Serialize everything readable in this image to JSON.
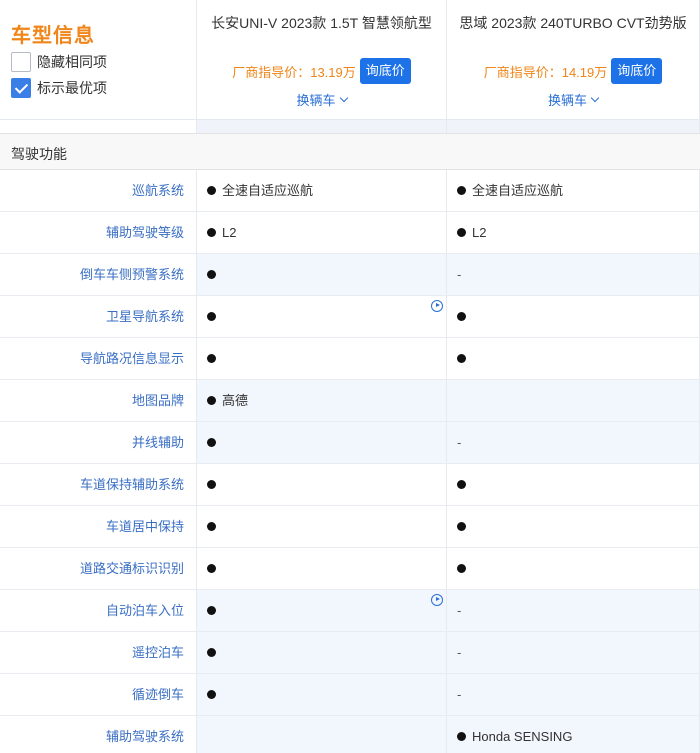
{
  "header": {
    "title": "车型信息",
    "hide_same_label": "隐藏相同项",
    "hide_same_checked": false,
    "mark_best_label": "标示最优项",
    "mark_best_checked": true,
    "cars": [
      {
        "name": "长安UNI-V 2023款 1.5T 智慧领航型",
        "price_label": "厂商指导价：",
        "price": "13.19万",
        "ask_label": "询底价",
        "swap_label": "换辆车"
      },
      {
        "name": "思域 2023款 240TURBO CVT劲势版",
        "price_label": "厂商指导价：",
        "price": "14.19万",
        "ask_label": "询底价",
        "swap_label": "换辆车"
      }
    ]
  },
  "section": {
    "title": "驾驶功能"
  },
  "rows": [
    {
      "label": "巡航系统",
      "highlight": false,
      "cells": [
        {
          "dot": true,
          "text": "全速自适应巡航"
        },
        {
          "dot": true,
          "text": "全速自适应巡航"
        }
      ]
    },
    {
      "label": "辅助驾驶等级",
      "highlight": false,
      "cells": [
        {
          "dot": true,
          "text": "L2"
        },
        {
          "dot": true,
          "text": "L2"
        }
      ]
    },
    {
      "label": "倒车车侧预警系统",
      "highlight": true,
      "cells": [
        {
          "dot": true,
          "text": ""
        },
        {
          "dot": false,
          "text": "-"
        }
      ]
    },
    {
      "label": "卫星导航系统",
      "highlight": false,
      "play": true,
      "cells": [
        {
          "dot": true,
          "text": ""
        },
        {
          "dot": true,
          "text": ""
        }
      ]
    },
    {
      "label": "导航路况信息显示",
      "highlight": false,
      "cells": [
        {
          "dot": true,
          "text": ""
        },
        {
          "dot": true,
          "text": ""
        }
      ]
    },
    {
      "label": "地图品牌",
      "highlight": true,
      "cells": [
        {
          "dot": true,
          "text": "高德"
        },
        {
          "dot": false,
          "text": ""
        }
      ]
    },
    {
      "label": "并线辅助",
      "highlight": true,
      "cells": [
        {
          "dot": true,
          "text": ""
        },
        {
          "dot": false,
          "text": "-"
        }
      ]
    },
    {
      "label": "车道保持辅助系统",
      "highlight": false,
      "cells": [
        {
          "dot": true,
          "text": ""
        },
        {
          "dot": true,
          "text": ""
        }
      ]
    },
    {
      "label": "车道居中保持",
      "highlight": false,
      "cells": [
        {
          "dot": true,
          "text": ""
        },
        {
          "dot": true,
          "text": ""
        }
      ]
    },
    {
      "label": "道路交通标识识别",
      "highlight": false,
      "cells": [
        {
          "dot": true,
          "text": ""
        },
        {
          "dot": true,
          "text": ""
        }
      ]
    },
    {
      "label": "自动泊车入位",
      "highlight": true,
      "play": true,
      "cells": [
        {
          "dot": true,
          "text": ""
        },
        {
          "dot": false,
          "text": "-"
        }
      ]
    },
    {
      "label": "遥控泊车",
      "highlight": true,
      "cells": [
        {
          "dot": true,
          "text": ""
        },
        {
          "dot": false,
          "text": "-"
        }
      ]
    },
    {
      "label": "循迹倒车",
      "highlight": true,
      "cells": [
        {
          "dot": true,
          "text": ""
        },
        {
          "dot": false,
          "text": "-"
        }
      ]
    },
    {
      "label": "辅助驾驶系统",
      "highlight": true,
      "cells": [
        {
          "dot": false,
          "text": ""
        },
        {
          "dot": true,
          "text": "Honda SENSING"
        }
      ]
    }
  ]
}
